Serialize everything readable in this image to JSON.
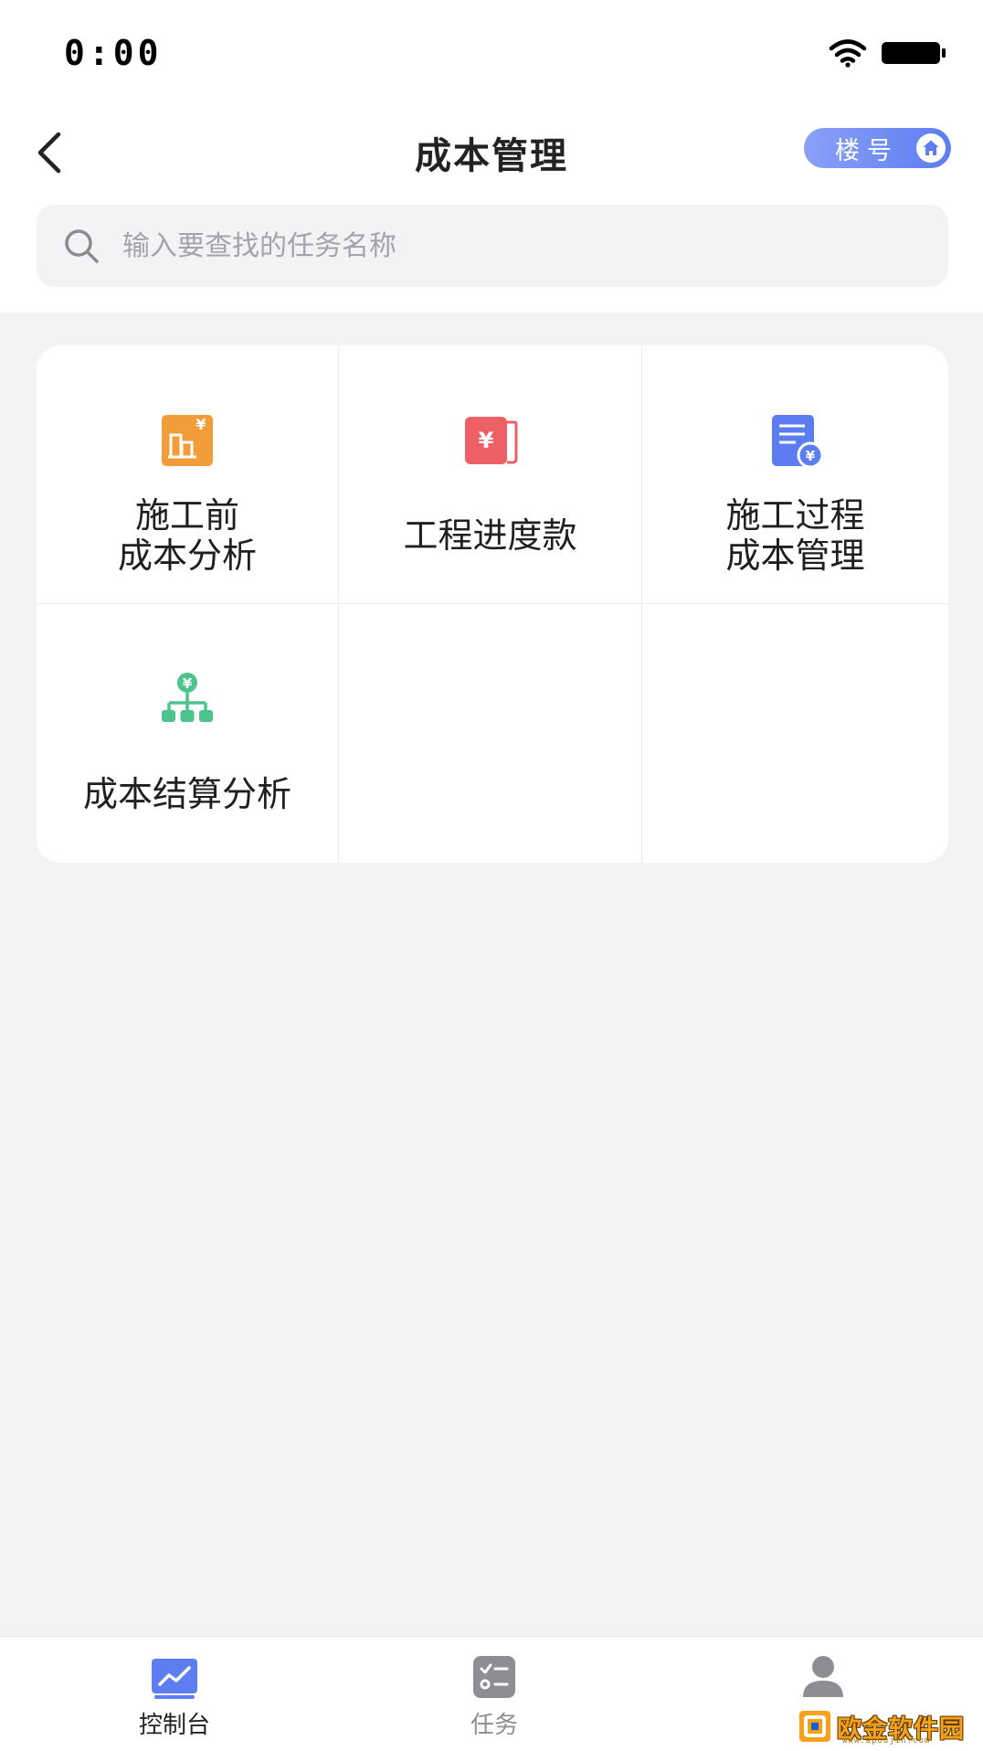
{
  "status_bar": {
    "time": "0:00"
  },
  "nav": {
    "title": "成本管理",
    "building_button": "楼号"
  },
  "search": {
    "placeholder": "输入要查找的任务名称",
    "value": ""
  },
  "grid": {
    "items": [
      {
        "label": "施工前\n成本分析",
        "icon": "building-yuan-icon",
        "color": "#f39c3a"
      },
      {
        "label": "工程进度款",
        "icon": "yuan-wallet-icon",
        "color": "#ec6066"
      },
      {
        "label": "施工过程\n成本管理",
        "icon": "document-yuan-icon",
        "color": "#5b7df0"
      },
      {
        "label": "成本结算分析",
        "icon": "yuan-hierarchy-icon",
        "color": "#4cc48b"
      }
    ]
  },
  "tabbar": {
    "items": [
      {
        "label": "控制台",
        "icon": "dashboard-chart-icon",
        "active": true
      },
      {
        "label": "任务",
        "icon": "task-list-icon",
        "active": false
      },
      {
        "label": "",
        "icon": "user-icon",
        "active": false
      }
    ]
  },
  "watermark": {
    "text": "欧金软件园",
    "url": "www.apoujin.com"
  },
  "colors": {
    "accent": "#5d7ef1",
    "background": "#f2f3f5"
  }
}
